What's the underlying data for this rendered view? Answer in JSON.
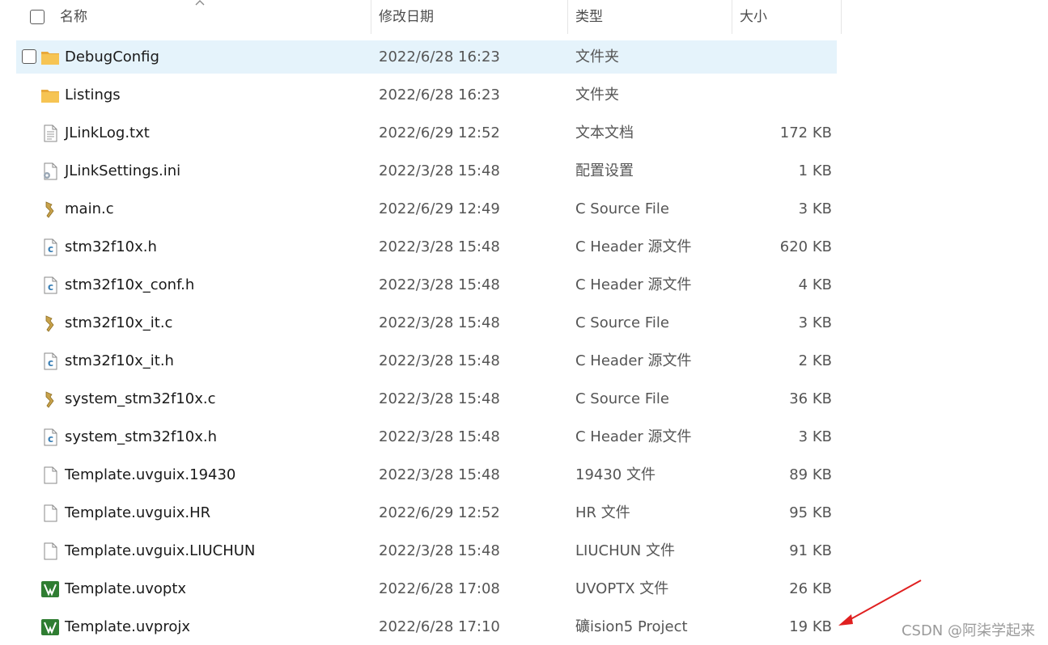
{
  "header": {
    "name": "名称",
    "date": "修改日期",
    "type": "类型",
    "size": "大小"
  },
  "files": [
    {
      "name": "DebugConfig",
      "date": "2022/6/28 16:23",
      "type": "文件夹",
      "size": "",
      "icon": "folder-icon",
      "selected": true
    },
    {
      "name": "Listings",
      "date": "2022/6/28 16:23",
      "type": "文件夹",
      "size": "",
      "icon": "folder-icon"
    },
    {
      "name": "JLinkLog.txt",
      "date": "2022/6/29 12:52",
      "type": "文本文档",
      "size": "172 KB",
      "icon": "text-file-icon"
    },
    {
      "name": "JLinkSettings.ini",
      "date": "2022/3/28 15:48",
      "type": "配置设置",
      "size": "1 KB",
      "icon": "settings-file-icon"
    },
    {
      "name": "main.c",
      "date": "2022/6/29 12:49",
      "type": "C Source File",
      "size": "3 KB",
      "icon": "c-source-icon"
    },
    {
      "name": "stm32f10x.h",
      "date": "2022/3/28 15:48",
      "type": "C Header 源文件",
      "size": "620 KB",
      "icon": "c-header-icon"
    },
    {
      "name": "stm32f10x_conf.h",
      "date": "2022/3/28 15:48",
      "type": "C Header 源文件",
      "size": "4 KB",
      "icon": "c-header-icon"
    },
    {
      "name": "stm32f10x_it.c",
      "date": "2022/3/28 15:48",
      "type": "C Source File",
      "size": "3 KB",
      "icon": "c-source-icon"
    },
    {
      "name": "stm32f10x_it.h",
      "date": "2022/3/28 15:48",
      "type": "C Header 源文件",
      "size": "2 KB",
      "icon": "c-header-icon"
    },
    {
      "name": "system_stm32f10x.c",
      "date": "2022/3/28 15:48",
      "type": "C Source File",
      "size": "36 KB",
      "icon": "c-source-icon"
    },
    {
      "name": "system_stm32f10x.h",
      "date": "2022/3/28 15:48",
      "type": "C Header 源文件",
      "size": "3 KB",
      "icon": "c-header-icon"
    },
    {
      "name": "Template.uvguix.19430",
      "date": "2022/3/28 15:48",
      "type": "19430 文件",
      "size": "89 KB",
      "icon": "blank-file-icon"
    },
    {
      "name": "Template.uvguix.HR",
      "date": "2022/6/29 12:52",
      "type": "HR 文件",
      "size": "95 KB",
      "icon": "blank-file-icon"
    },
    {
      "name": "Template.uvguix.LIUCHUN",
      "date": "2022/3/28 15:48",
      "type": "LIUCHUN 文件",
      "size": "91 KB",
      "icon": "blank-file-icon"
    },
    {
      "name": "Template.uvoptx",
      "date": "2022/6/28 17:08",
      "type": "UVOPTX 文件",
      "size": "26 KB",
      "icon": "keil-uvision-icon"
    },
    {
      "name": "Template.uvprojx",
      "date": "2022/6/28 17:10",
      "type": "礦ision5 Project",
      "size": "19 KB",
      "icon": "keil-uvision-icon"
    }
  ],
  "watermark": "CSDN @阿柒学起来",
  "colors": {
    "selected_row": "#e5f3fb",
    "folder": "#f6c453",
    "arrow": "#e02020",
    "keil_green": "#2f7d32"
  }
}
